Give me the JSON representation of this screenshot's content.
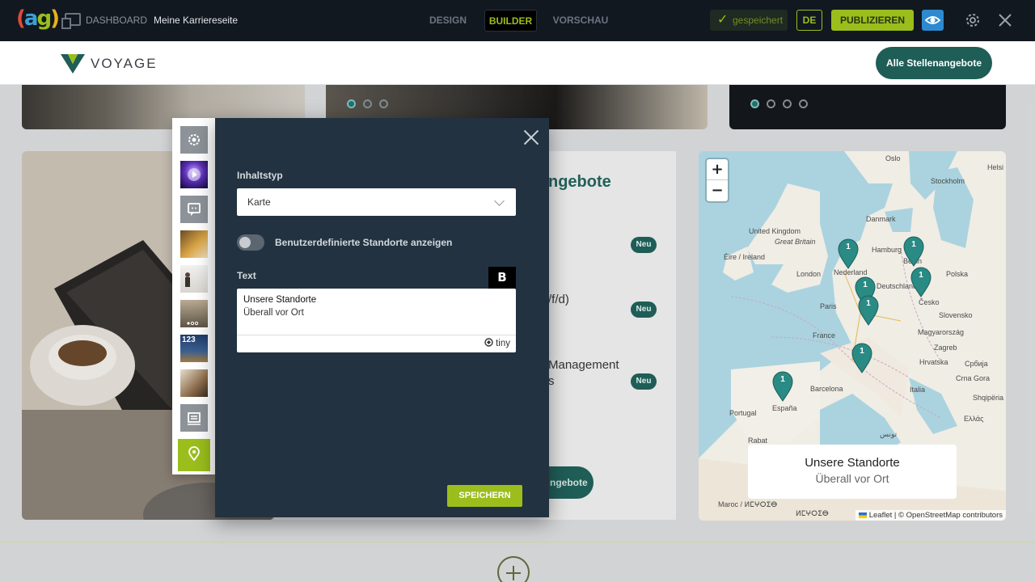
{
  "topbar": {
    "logo_text": "(ag)",
    "dashboard_label": "DASHBOARD",
    "page_name": "Meine Karriereseite",
    "tabs": [
      {
        "label": "DESIGN"
      },
      {
        "label": "BUILDER",
        "active": true
      },
      {
        "label": "VORSCHAU"
      }
    ],
    "saved_label": "gespeichert",
    "language": "DE",
    "publish_label": "PUBLIZIEREN",
    "icons": [
      "eye-icon",
      "gear-icon",
      "close-icon"
    ],
    "accent_color": "#9bbe1c"
  },
  "site": {
    "brand_name": "VOYAGE",
    "all_jobs_button": "Alle Stellenangebote",
    "brand_color": "#1f5d57"
  },
  "background_content": {
    "heading_fragment": "ngebote",
    "job_fragments": [
      "/f/d)",
      "Management",
      "s"
    ],
    "badge_label": "Neu",
    "button_fragment": "ngebote"
  },
  "sections_rail": {
    "items": [
      {
        "name": "settings",
        "icon": "gear-icon"
      },
      {
        "name": "video-hero",
        "icon": "play-icon"
      },
      {
        "name": "quote",
        "icon": "quote-icon"
      },
      {
        "name": "image-text",
        "icon": "image-icon"
      },
      {
        "name": "team-image",
        "icon": "image-icon"
      },
      {
        "name": "slider",
        "icon": "image-icon"
      },
      {
        "name": "numbers",
        "label": "123",
        "icon": "image-icon"
      },
      {
        "name": "gallery",
        "icon": "image-icon"
      },
      {
        "name": "job-list",
        "icon": "list-icon"
      },
      {
        "name": "map",
        "icon": "map-pin-icon",
        "active": true
      }
    ]
  },
  "dialog": {
    "content_type_label": "Inhaltstyp",
    "content_type_value": "Karte",
    "custom_locations_label": "Benutzerdefinierte Standorte anzeigen",
    "custom_locations_enabled": false,
    "text_label": "Text",
    "bold_button": "B",
    "editor_line1": "Unsere Standorte",
    "editor_line2": "Überall vor Ort",
    "editor_brand": "tiny",
    "save_label": "SPEICHERN"
  },
  "map": {
    "zoom_in": "+",
    "zoom_out": "−",
    "labels": [
      "Oslo",
      "Helsi",
      "Stockholm",
      "Danmark",
      "United Kingdom",
      "Great Britain",
      "Éire / Ireland",
      "London",
      "Nederland",
      "Hamburg",
      "Berlin",
      "Deutschland",
      "Polska",
      "Paris",
      "Česko",
      "Slovensko",
      "France",
      "Magyarország",
      "Zagreb",
      "Hrvatska",
      "Србија",
      "Italia",
      "Barcelona",
      "Portugal",
      "España",
      "Rabat",
      "Crna Gora",
      "Ελλάς",
      "Maroc / ⵍⵎⵖⵔⵉⴱ",
      "ⵍⵎⵖⵔⵉⴱ",
      "تونس",
      "Shqipëria"
    ],
    "markers": [
      {
        "city": "Amsterdam",
        "count": "1"
      },
      {
        "city": "Berlin",
        "count": "1"
      },
      {
        "city": "Prague",
        "count": "1"
      },
      {
        "city": "Frankfurt",
        "count": "1"
      },
      {
        "city": "Stuttgart",
        "count": "1"
      },
      {
        "city": "Milan",
        "count": "1"
      },
      {
        "city": "Madrid",
        "count": "1"
      }
    ],
    "popup_title": "Unsere Standorte",
    "popup_subtitle": "Überall vor Ort",
    "attribution_leaflet": "Leaflet",
    "attribution_osm": " | © OpenStreetMap contributors",
    "marker_color": "#2a8a84"
  }
}
